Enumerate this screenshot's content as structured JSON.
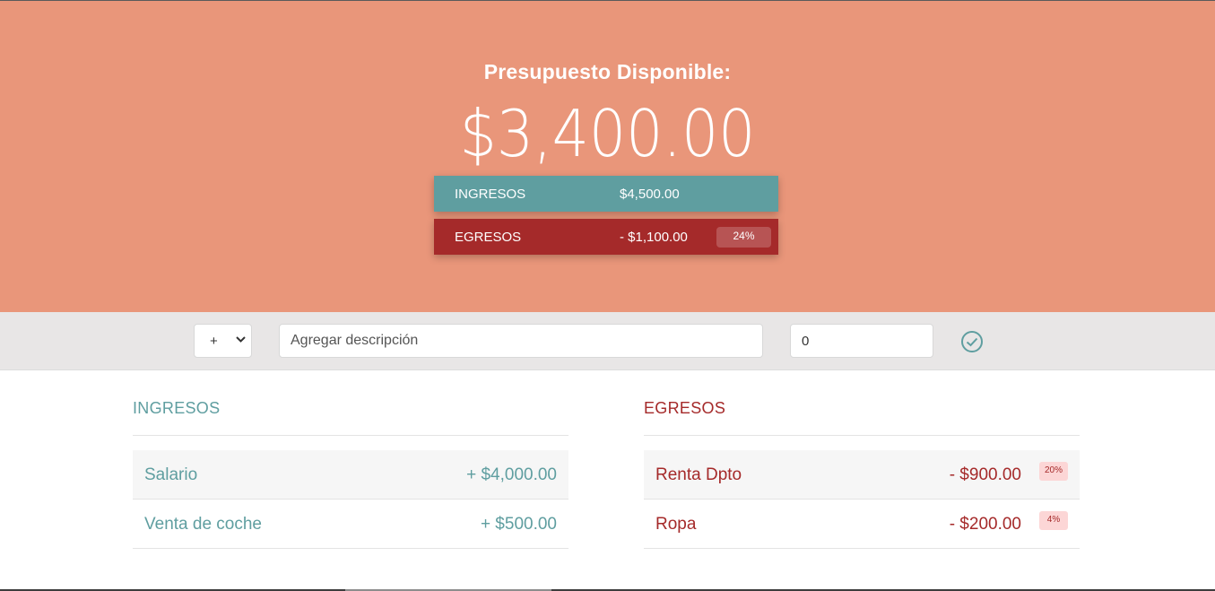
{
  "header": {
    "title": "Presupuesto Disponible:",
    "available": "$3,400.00",
    "background_color": "#e9967a"
  },
  "summary": {
    "income": {
      "label": "INGRESOS",
      "value": "$4,500.00",
      "color": "#5f9ea0"
    },
    "expense": {
      "label": "EGRESOS",
      "value": "- $1,100.00",
      "percentage": "24%",
      "color": "#a52a2a"
    }
  },
  "form": {
    "type_selected": "+",
    "type_icon": "chevron-down-icon",
    "description_placeholder": "Agregar descripción",
    "value": "0",
    "submit_icon": "check-circle-icon"
  },
  "income_list": {
    "title": "INGRESOS",
    "items": [
      {
        "description": "Salario",
        "amount": "+ $4,000.00"
      },
      {
        "description": "Venta de coche",
        "amount": "+ $500.00"
      }
    ]
  },
  "expense_list": {
    "title": "EGRESOS",
    "items": [
      {
        "description": "Renta Dpto",
        "amount": "- $900.00",
        "percentage": "20%"
      },
      {
        "description": "Ropa",
        "amount": "- $200.00",
        "percentage": "4%"
      }
    ]
  }
}
